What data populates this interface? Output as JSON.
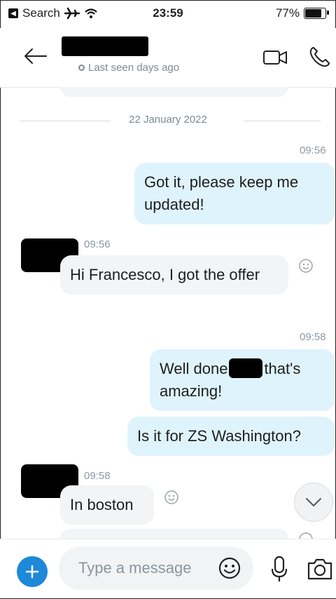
{
  "status_bar": {
    "carrier": "Search",
    "time": "23:59",
    "battery": "77%",
    "battery_level": 0.77
  },
  "header": {
    "last_seen": "Last seen days ago"
  },
  "date_separator": "22 January 2022",
  "messages": {
    "m1_time": "09:56",
    "m1_text": "Got it, please keep me updated!",
    "m2_time": "09:56",
    "m2_text": "Hi Francesco, I got the offer",
    "m3_time": "09:58",
    "m3_text_a": "Well done",
    "m3_text_b": "that's amazing!",
    "m4_text": "Is it for ZS Washington?",
    "m5_time": "09:58",
    "m5_text": "In boston"
  },
  "composer": {
    "placeholder": "Type a message"
  },
  "icons": {
    "back": "arrow-left-icon",
    "video": "video-call-icon",
    "call": "phone-icon",
    "add": "plus-icon",
    "emoji": "smiley-icon",
    "mic": "microphone-icon",
    "camera": "camera-icon",
    "scroll": "chevron-down-icon"
  },
  "colors": {
    "accent": "#1e88d9",
    "outgoing_bubble": "#dff3fd",
    "incoming_bubble": "#f2f4f6"
  }
}
